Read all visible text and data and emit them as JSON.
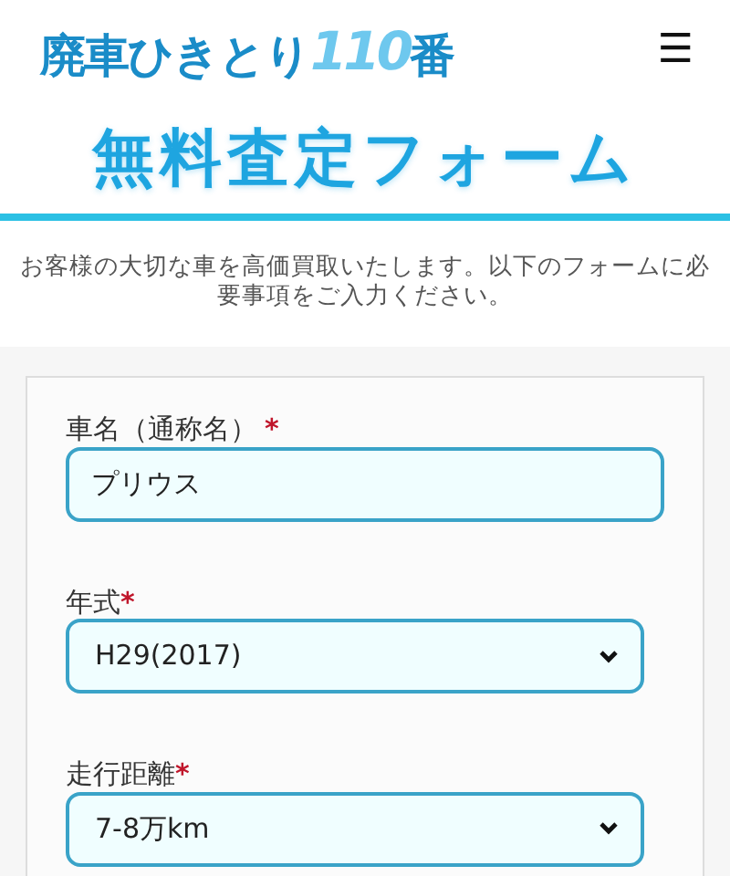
{
  "header": {
    "logo": {
      "main": "廃車ひきとり",
      "number": "110",
      "suffix": "番"
    },
    "menu_icon": "☰"
  },
  "title": "無料査定フォーム",
  "intro": "お客様の大切な車を高価買取いたします。以下のフォームに必要事項をご入力ください。",
  "form": {
    "fields": [
      {
        "kind": "text",
        "label": "車名（通称名）",
        "required_mark": "*",
        "value": "プリウス"
      },
      {
        "kind": "select",
        "label": "年式",
        "required_mark": "*",
        "value": "H29(2017)"
      },
      {
        "kind": "select",
        "label": "走行距離",
        "required_mark": "*",
        "value": "7-8万km"
      }
    ]
  }
}
